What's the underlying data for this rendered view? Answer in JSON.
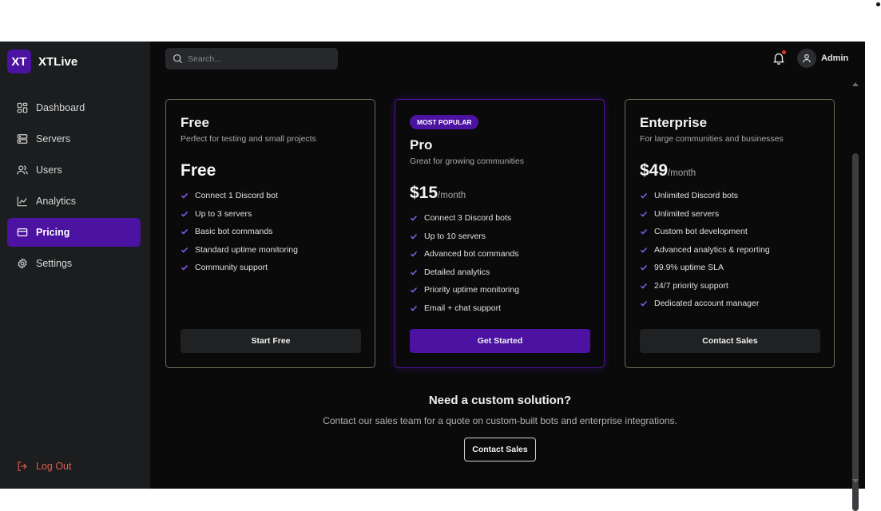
{
  "brand": {
    "logo": "XT",
    "name": "XTLive"
  },
  "sidebar": {
    "items": [
      {
        "label": "Dashboard",
        "icon": "dashboard-icon"
      },
      {
        "label": "Servers",
        "icon": "server-icon"
      },
      {
        "label": "Users",
        "icon": "users-icon"
      },
      {
        "label": "Analytics",
        "icon": "analytics-icon"
      },
      {
        "label": "Pricing",
        "icon": "credit-card-icon",
        "active": true
      },
      {
        "label": "Settings",
        "icon": "gear-icon"
      }
    ],
    "logout": "Log Out"
  },
  "topbar": {
    "search_placeholder": "Search...",
    "user": "Admin",
    "has_notification": true
  },
  "plans": [
    {
      "name": "Free",
      "description": "Perfect for testing and small projects",
      "price": "Free",
      "period": "",
      "features": [
        "Connect 1 Discord bot",
        "Up to 3 servers",
        "Basic bot commands",
        "Standard uptime monitoring",
        "Community support"
      ],
      "cta": "Start Free"
    },
    {
      "badge": "MOST POPULAR",
      "name": "Pro",
      "description": "Great for growing communities",
      "price": "$15",
      "period": "/month",
      "features": [
        "Connect 3 Discord bots",
        "Up to 10 servers",
        "Advanced bot commands",
        "Detailed analytics",
        "Priority uptime monitoring",
        "Email + chat support"
      ],
      "cta": "Get Started"
    },
    {
      "name": "Enterprise",
      "description": "For large communities and businesses",
      "price": "$49",
      "period": "/month",
      "features": [
        "Unlimited Discord bots",
        "Unlimited servers",
        "Custom bot development",
        "Advanced analytics & reporting",
        "99.9% uptime SLA",
        "24/7 priority support",
        "Dedicated account manager"
      ],
      "cta": "Contact Sales"
    }
  ],
  "custom": {
    "title": "Need a custom solution?",
    "text": "Contact our sales team for a quote on custom-built bots and enterprise integrations.",
    "button": "Contact Sales"
  },
  "colors": {
    "accent": "#4c12a1",
    "sidebar": "#1b1d1f",
    "background": "#0a0a0a",
    "logout": "#e05a4f",
    "notification": "#e0352b"
  }
}
